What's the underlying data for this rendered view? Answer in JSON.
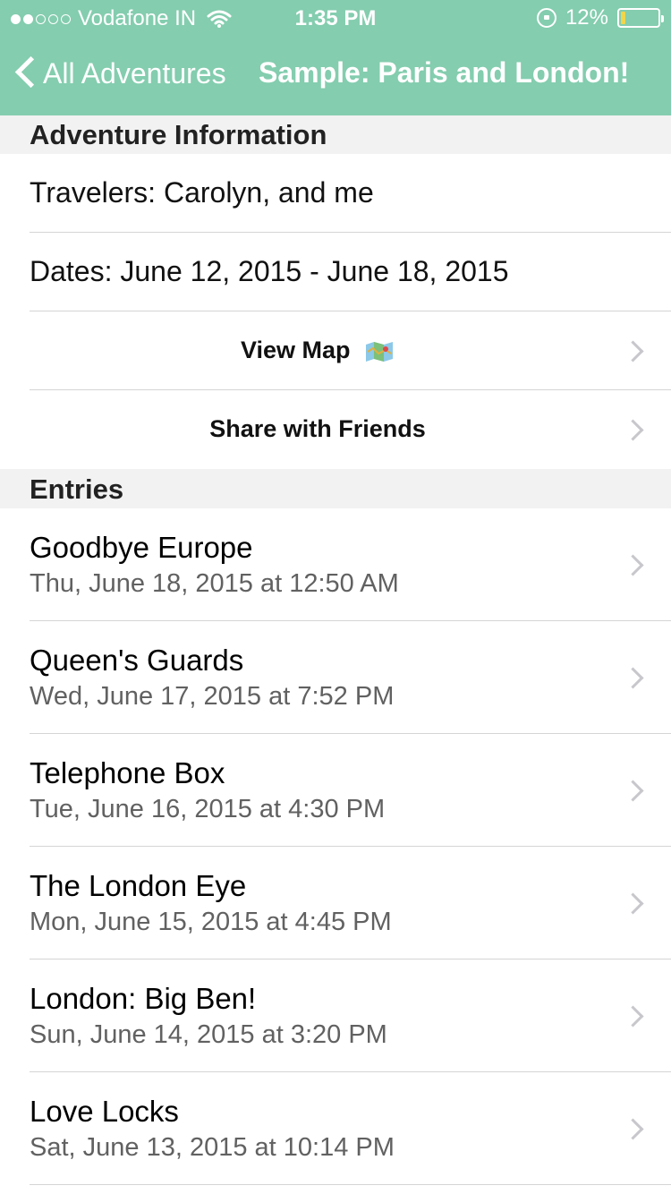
{
  "status": {
    "carrier": "Vodafone IN",
    "signal_dots_filled": 2,
    "signal_dots_total": 5,
    "time": "1:35 PM",
    "battery_text": "12%",
    "battery_level_percent": 12,
    "battery_fill_color": "#f2d54a"
  },
  "nav": {
    "back_label": "All Adventures",
    "title": "Sample: Paris and London!",
    "bar_color": "#84cdaf"
  },
  "sections": {
    "info_header": "Adventure Information",
    "entries_header": "Entries"
  },
  "info": {
    "travelers": "Travelers: Carolyn, and me",
    "dates": "Dates: June 12, 2015 - June 18, 2015",
    "view_map": "View Map",
    "view_map_icon": "map-icon",
    "share": "Share with Friends"
  },
  "entries": [
    {
      "title": "Goodbye Europe",
      "date": "Thu, June 18, 2015 at 12:50 AM"
    },
    {
      "title": "Queen's Guards",
      "date": "Wed, June 17, 2015 at 7:52 PM"
    },
    {
      "title": "Telephone Box",
      "date": "Tue, June 16, 2015 at 4:30 PM"
    },
    {
      "title": "The London Eye",
      "date": "Mon, June 15, 2015 at 4:45 PM"
    },
    {
      "title": "London: Big Ben!",
      "date": "Sun, June 14, 2015 at 3:20 PM"
    },
    {
      "title": "Love Locks",
      "date": "Sat, June 13, 2015 at 10:14 PM"
    }
  ]
}
